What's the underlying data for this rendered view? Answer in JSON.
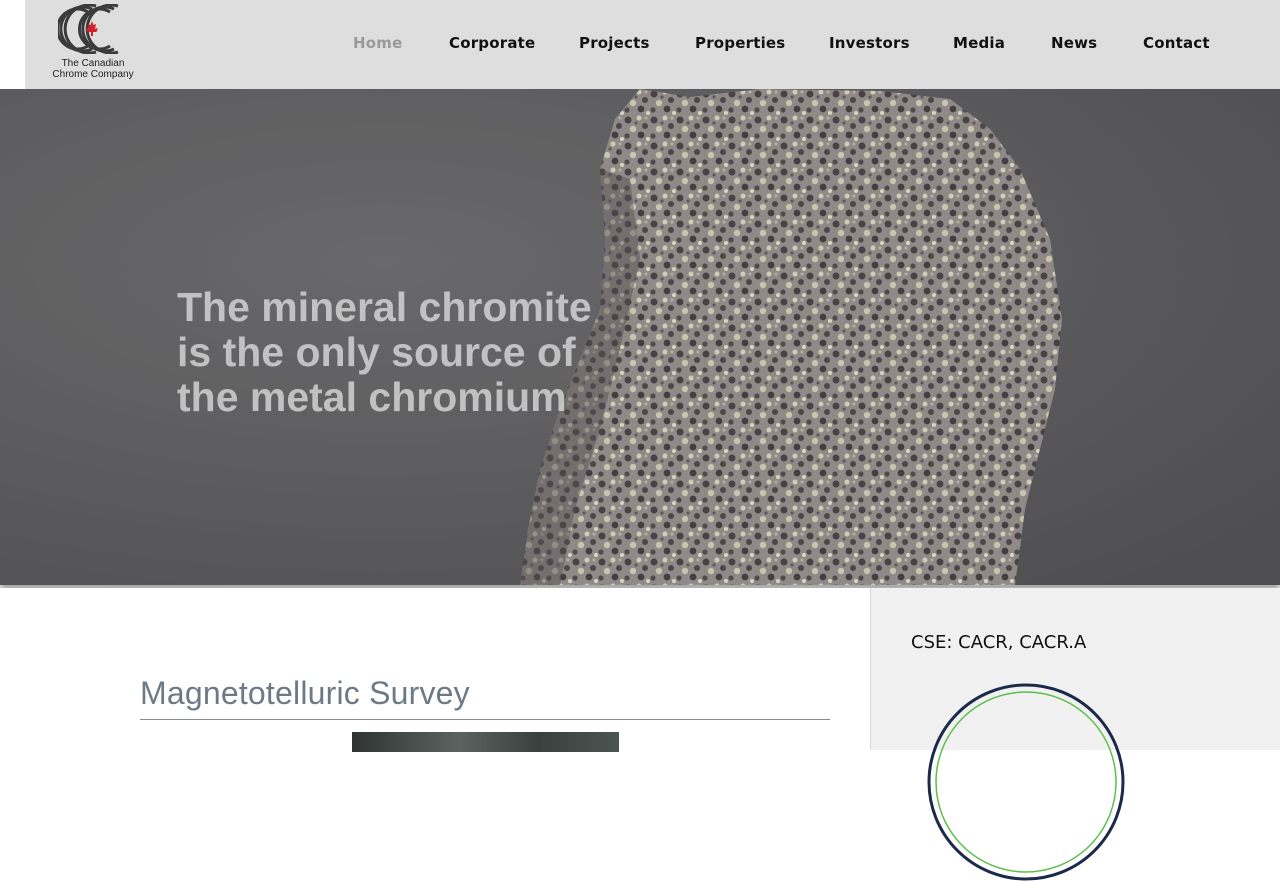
{
  "header": {
    "logo": {
      "line1": "The Canadian",
      "line2": "Chrome Company"
    },
    "nav": [
      {
        "label": "Home",
        "active": true
      },
      {
        "label": "Corporate",
        "active": false
      },
      {
        "label": "Projects",
        "active": false
      },
      {
        "label": "Properties",
        "active": false
      },
      {
        "label": "Investors",
        "active": false
      },
      {
        "label": "Media",
        "active": false
      },
      {
        "label": "News",
        "active": false
      },
      {
        "label": "Contact",
        "active": false
      }
    ]
  },
  "hero": {
    "headline": "The mineral chromite is the only source of the metal chromium"
  },
  "main": {
    "section_title": "Magnetotelluric Survey"
  },
  "sidebar": {
    "ticker": "CSE: CACR, CACR.A"
  },
  "colors": {
    "header_bg": "#dedede",
    "nav_active": "#999999",
    "nav_text": "#111111",
    "title_text": "#6d7a86",
    "logo_leaf": "#d4202b",
    "badge_outer": "#1b2a4a",
    "badge_inner": "#5cbf4a"
  }
}
